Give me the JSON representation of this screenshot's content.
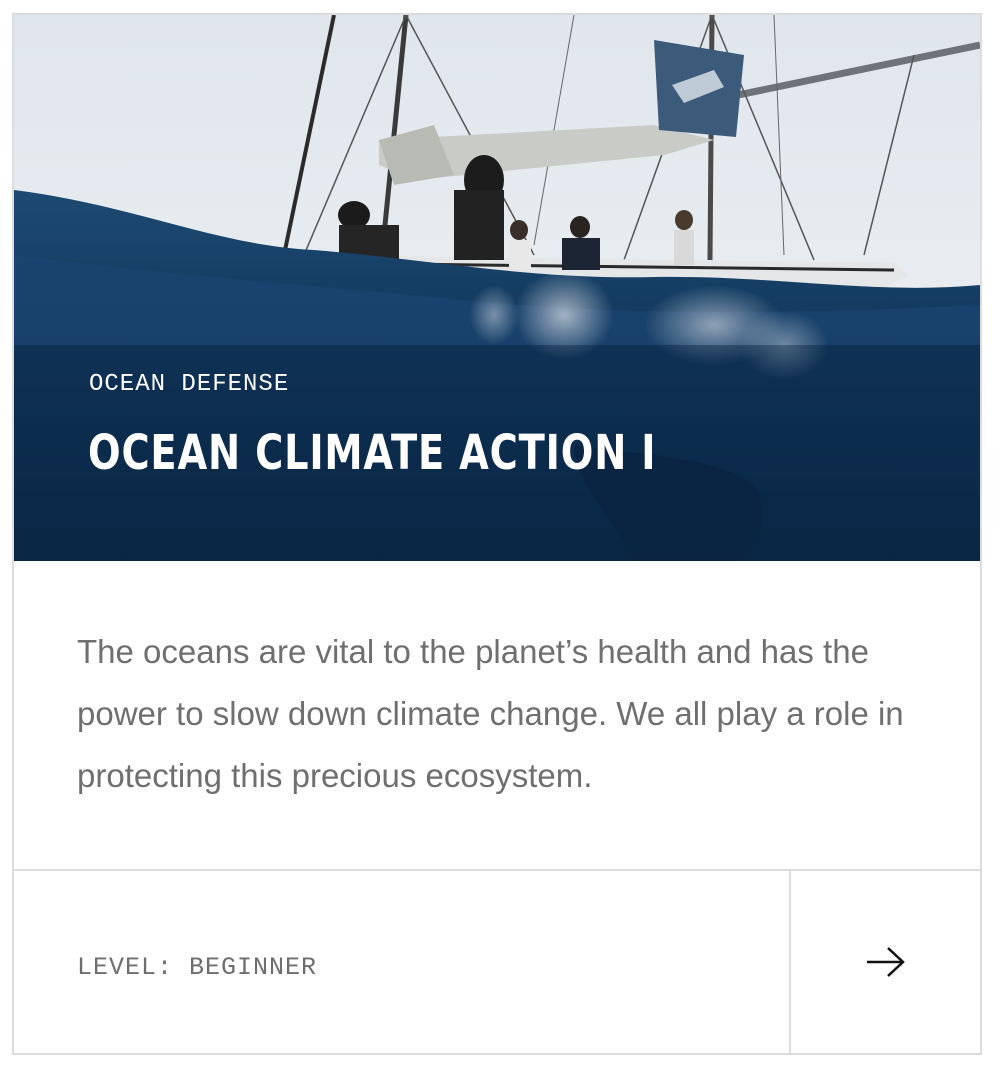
{
  "card": {
    "category": "OCEAN DEFENSE",
    "title": "OCEAN CLIMATE ACTION I",
    "description": "The oceans are vital to the planet’s health and has the power to slow down climate change. We all play a role in protecting this precious ecosystem.",
    "level": "LEVEL: BEGINNER",
    "arrow_icon": "arrow-right-icon"
  },
  "colors": {
    "ocean_deep": "#0c2c4d",
    "sky": "#e8edf2",
    "text_gray": "#6f6f6f",
    "border": "#dcdcdc"
  }
}
